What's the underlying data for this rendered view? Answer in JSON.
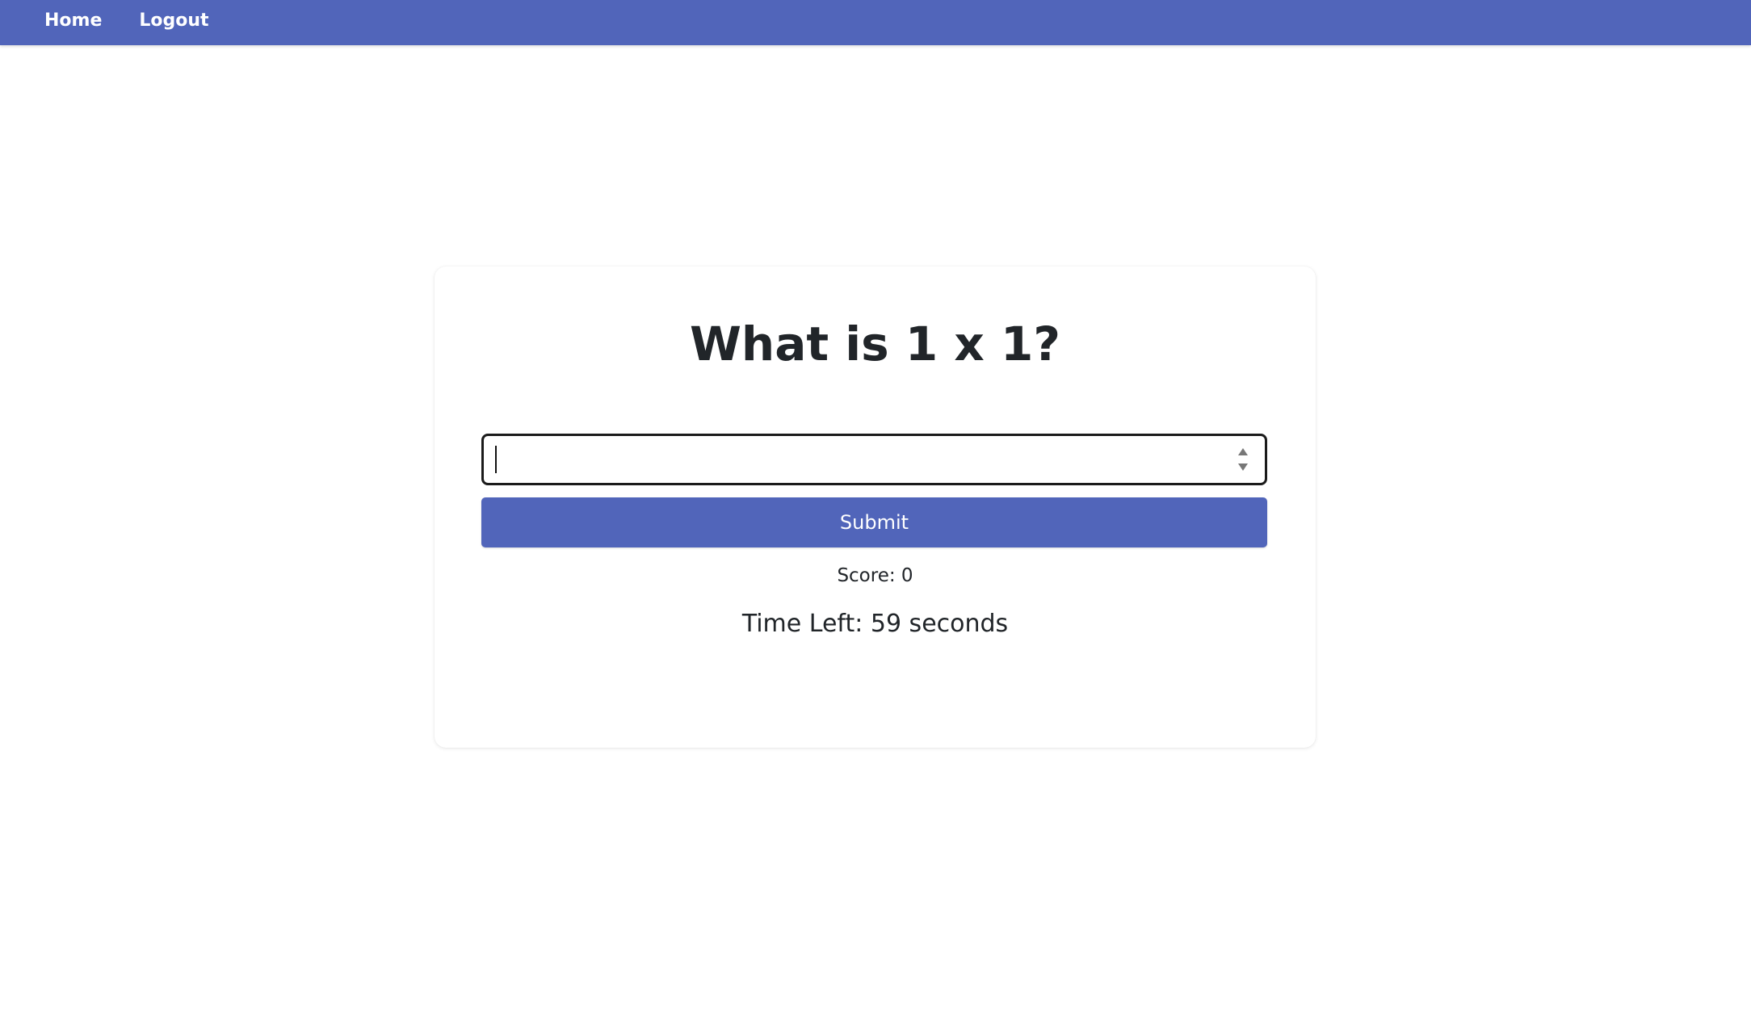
{
  "nav": {
    "home_label": "Home",
    "logout_label": "Logout"
  },
  "quiz": {
    "question": "What is 1 x 1?",
    "answer_value": "",
    "submit_label": "Submit",
    "score_text": "Score: 0",
    "time_left_text": "Time Left: 59 seconds"
  },
  "colors": {
    "accent": "#5165ba",
    "text": "#212529",
    "background": "#ffffff"
  },
  "icons": {
    "spinner_up": "spinner-up-icon",
    "spinner_down": "spinner-down-icon"
  }
}
